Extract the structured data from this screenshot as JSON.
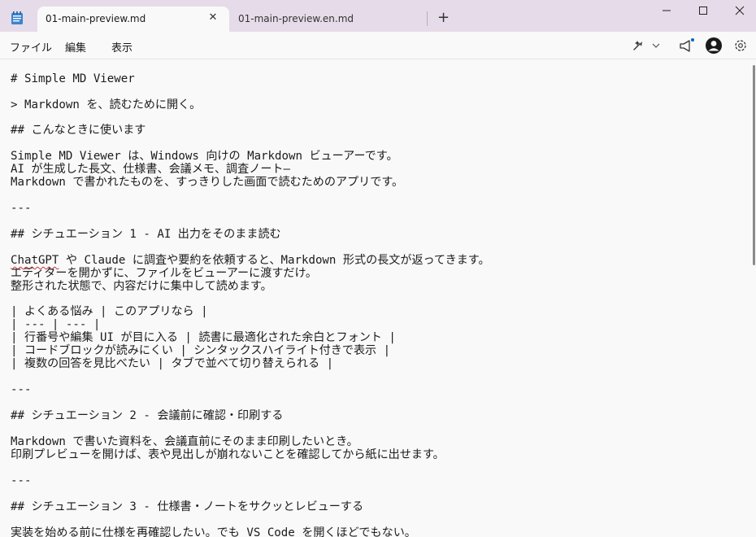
{
  "tabs": [
    {
      "label": "01-main-preview.md",
      "active": true
    },
    {
      "label": "01-main-preview.en.md",
      "active": false
    }
  ],
  "new_tab": "+",
  "menu": [
    "ファイル",
    "編集",
    "表示"
  ],
  "icons": [
    "notepad-icon",
    "copilot-icon",
    "megaphone-icon",
    "account-icon",
    "gear-icon"
  ],
  "editor": {
    "lines": [
      "# Simple MD Viewer",
      "> Markdown を、読むために開く。",
      "## こんなときに使います",
      "Simple MD Viewer は、Windows 向けの Markdown ビューアーです。",
      "AI が生成した長文、仕様書、会議メモ、調査ノート—",
      "Markdown で書かれたものを、すっきりした画面で読むためのアプリです。",
      "---",
      "## シチュエーション 1 - AI 出力をそのまま読む",
      "ChatGPT",
      " や Claude に調査や要約を依頼すると、Markdown 形式の長文が返ってきます。",
      "エディターを開かずに、ファイルをビューアーに渡すだけ。",
      "整形された状態で、内容だけに集中して読めます。",
      "| よくある悩み | このアプリなら |",
      "| --- | --- |",
      "| 行番号や編集 UI が目に入る | 読書に最適化された余白とフォント |",
      "| コードブロックが読みにくい | シンタックスハイライト付きで表示 |",
      "| 複数の回答を見比べたい | タブで並べて切り替えられる |",
      "---",
      "## シチュエーション 2 - 会議前に確認・印刷する",
      "Markdown で書いた資料を、会議直前にそのまま印刷したいとき。",
      "印刷プレビューを開けば、表や見出しが崩れないことを確認してから紙に出せます。",
      "---",
      "## シチュエーション 3 - 仕様書・ノートをサクッとレビューする",
      "実装を始める前に仕様を再確認したい。でも VS Code を開くほどでもない。"
    ]
  },
  "colors": {
    "titlebar": "#e6dbe8",
    "background": "#f9f9f9",
    "text": "#1b1b1b",
    "spellcheck": "#d13438"
  }
}
